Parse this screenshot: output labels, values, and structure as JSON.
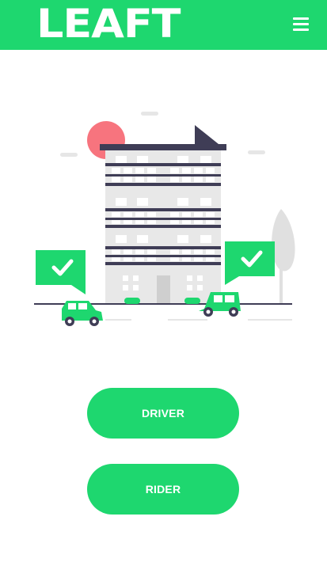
{
  "header": {
    "logo_text": "LEAFT",
    "menu_icon": "hamburger-menu-icon"
  },
  "colors": {
    "brand_green": "#1ed76f",
    "building_dark": "#3f3d56",
    "sun_pink": "#f7747e"
  },
  "illustration": {
    "icons": [
      "building",
      "car",
      "check-bubble",
      "tree",
      "sun"
    ]
  },
  "actions": {
    "driver_label": "DRIVER",
    "rider_label": "RIDER"
  }
}
